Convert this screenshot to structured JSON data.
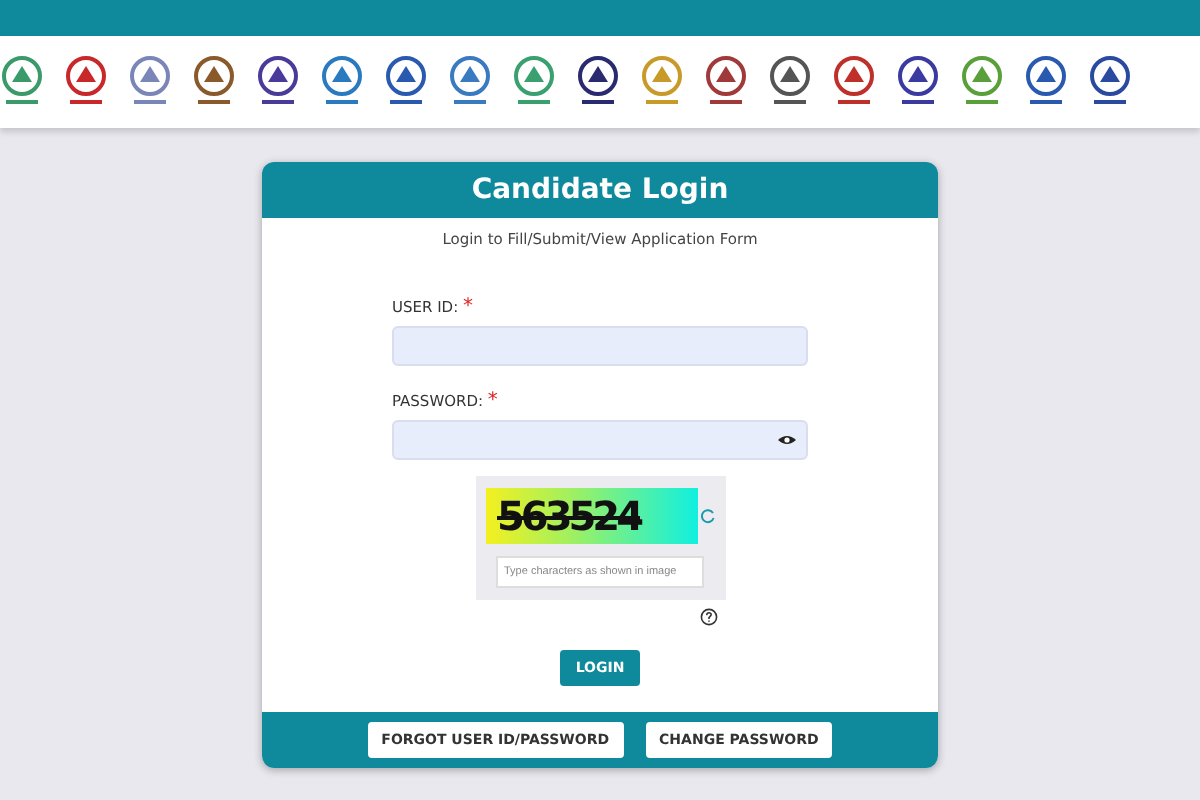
{
  "logos": [
    {
      "color": "#3a9a6a"
    },
    {
      "color": "#c8282a"
    },
    {
      "color": "#7a86b8"
    },
    {
      "color": "#8a5a2a"
    },
    {
      "color": "#4a3a9a"
    },
    {
      "color": "#2a7ac0"
    },
    {
      "color": "#2a5ab0"
    },
    {
      "color": "#3a7ac0"
    },
    {
      "color": "#3aa070"
    },
    {
      "color": "#2a2a70"
    },
    {
      "color": "#c89a2a"
    },
    {
      "color": "#a03a3a"
    },
    {
      "color": "#555555"
    },
    {
      "color": "#c0302a"
    },
    {
      "color": "#3a3aa0"
    },
    {
      "color": "#5aa03a"
    },
    {
      "color": "#2a5ab0"
    },
    {
      "color": "#2a4aa0"
    }
  ],
  "card": {
    "title": "Candidate Login",
    "subtitle": "Login to Fill/Submit/View Application Form"
  },
  "fields": [
    {
      "label": "USER ID:",
      "required": "*",
      "kind": "text"
    },
    {
      "label": "PASSWORD:",
      "required": "*",
      "kind": "password"
    }
  ],
  "captcha": {
    "code": "563524",
    "placeholder": "Type characters as shown in image"
  },
  "login_button": "LOGIN",
  "footer_buttons": [
    "FORGOT USER ID/PASSWORD",
    "CHANGE PASSWORD"
  ]
}
